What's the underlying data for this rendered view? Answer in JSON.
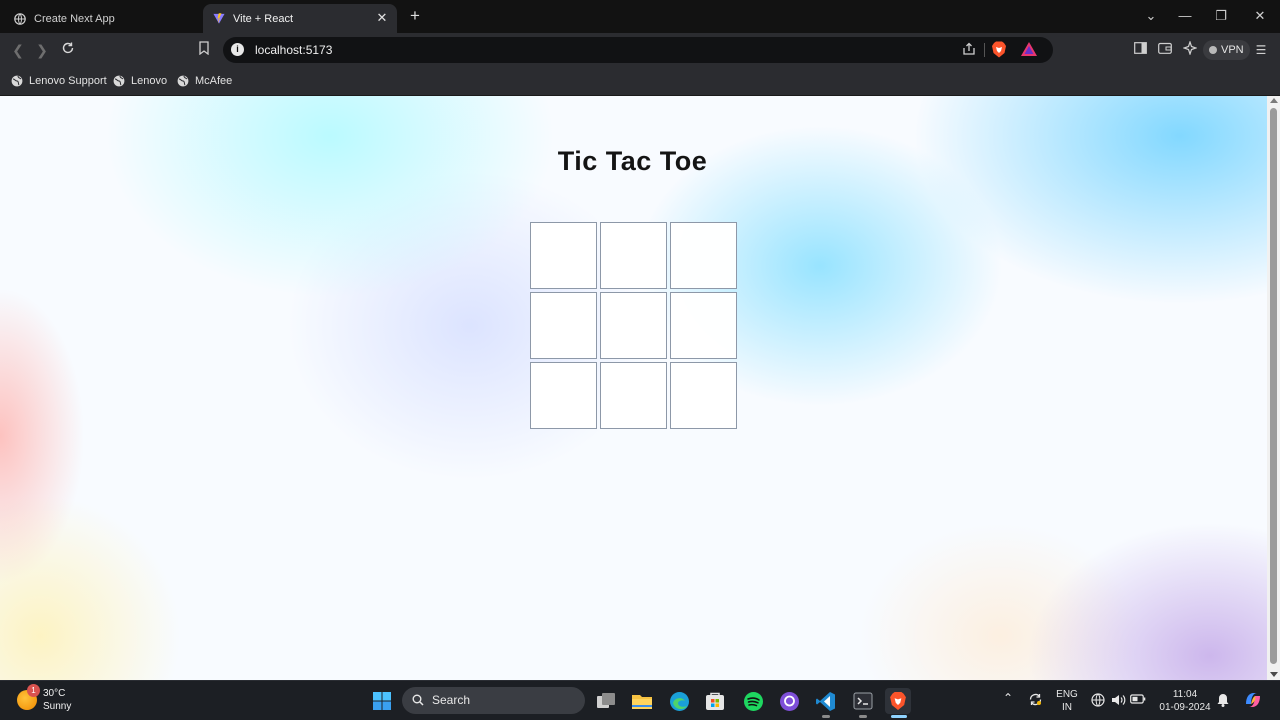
{
  "browser": {
    "tabs": [
      {
        "label": "Create Next App",
        "active": false
      },
      {
        "label": "Vite + React",
        "active": true
      }
    ],
    "url": "localhost:5173",
    "vpn_label": "VPN",
    "bookmarks": [
      {
        "label": "Lenovo Support"
      },
      {
        "label": "Lenovo"
      },
      {
        "label": "McAfee"
      }
    ]
  },
  "page": {
    "title": "Tic Tac Toe",
    "board": [
      "",
      "",
      "",
      "",
      "",
      "",
      "",
      "",
      ""
    ]
  },
  "taskbar": {
    "weather": {
      "temp": "30°C",
      "condition": "Sunny",
      "badge": "1"
    },
    "search_label": "Search",
    "language": {
      "line1": "ENG",
      "line2": "IN"
    },
    "clock": {
      "time": "11:04",
      "date": "01-09-2024"
    }
  }
}
